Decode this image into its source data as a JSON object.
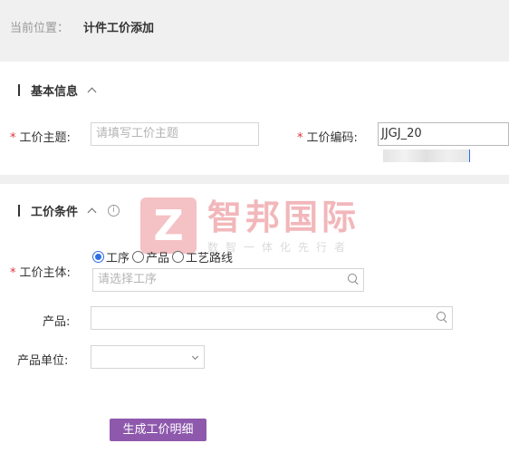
{
  "breadcrumb": {
    "label": "当前位置：",
    "current": "计件工价添加"
  },
  "basic_section": {
    "title": "基本信息",
    "topic": {
      "label": "工价主题:",
      "placeholder": "请填写工价主题",
      "value": ""
    },
    "code": {
      "label": "工价编码:",
      "value": "JJGJ_20"
    }
  },
  "condition_section": {
    "title": "工价条件",
    "info_icon": "i",
    "subject": {
      "label": "工价主体:",
      "options": [
        "工序",
        "产品",
        "工艺路线"
      ],
      "selected": "工序",
      "placeholder": "请选择工序"
    },
    "product": {
      "label": "产品:",
      "value": ""
    },
    "unit": {
      "label": "产品单位:",
      "value": ""
    }
  },
  "generate_button": "生成工价明细",
  "watermark": {
    "logo_letter": "Z",
    "name": "智邦国际",
    "slogan": "数智一体化先行者"
  },
  "colors": {
    "accent": "#8e59ad",
    "required": "#e0303b",
    "radio": "#2f6fe4",
    "band": "#f0f0f0"
  }
}
